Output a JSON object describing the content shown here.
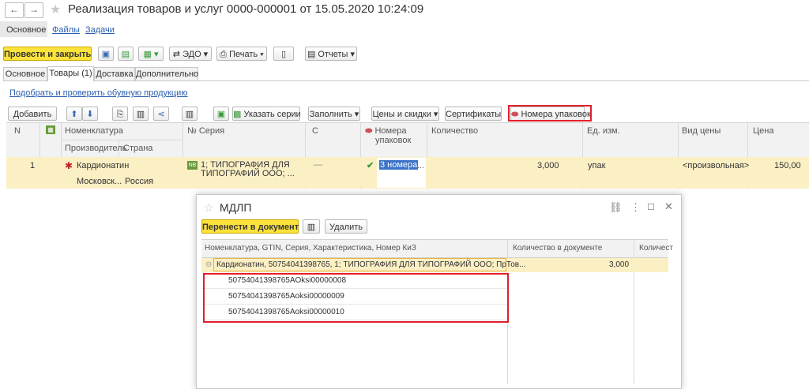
{
  "window": {
    "title": "Реализация товаров и услуг 0000-000001 от 15.05.2020 10:24:09",
    "back": "←",
    "forward": "→",
    "star": "★"
  },
  "nav": {
    "main": "Основное",
    "files": "Файлы",
    "tasks": "Задачи"
  },
  "toolbar": {
    "post_close": "Провести и закрыть",
    "edo": "ЭДО",
    "print": "Печать",
    "reports": "Отчеты"
  },
  "tabs": [
    {
      "label": "Основное"
    },
    {
      "label": "Товары (1)"
    },
    {
      "label": "Доставка"
    },
    {
      "label": "Дополнительно"
    }
  ],
  "pick_link": "Подобрать и проверить обувную продукцию",
  "goods_toolbar": {
    "add": "Добавить",
    "series": "Указать серии",
    "fill": "Заполнить",
    "prices": "Цены и скидки",
    "certs": "Сертификаты",
    "pack_numbers": "Номера упаковок"
  },
  "table": {
    "headers": {
      "n": "N",
      "nomenclature": "Номенклатура",
      "producer": "Производитель",
      "country": "Страна",
      "series": "Серия",
      "c": "С",
      "pack_numbers_1": "Номера",
      "pack_numbers_2": "упаковок",
      "quantity": "Количество",
      "unit": "Ед. изм.",
      "price_type": "Вид цены",
      "price": "Цена"
    },
    "rows": [
      {
        "n": "1",
        "nomenclature": "Кардионатин",
        "producer": "Московск...",
        "country": "Россия",
        "series_1": "1; ТИПОГРАФИЯ ДЛЯ",
        "series_2": "ТИПОГРАФИЙ ООО; ...",
        "c": "—",
        "pack_numbers": "3 номера",
        "pack_more": "...",
        "quantity": "3,000",
        "unit": "упак",
        "price_type": "<произвольная>",
        "price": "150,00"
      }
    ]
  },
  "dialog": {
    "title": "МДЛП",
    "transfer": "Перенести в документ",
    "delete": "Удалить",
    "col_nomenclature": "Номенклатура, GTIN, Серия, Характеристика, Номер КиЗ",
    "col_qty_doc": "Количество в документе",
    "col_qty": "Количест",
    "group_row": "Кардионатин, 50754041398765, 1; ТИПОГРАФИЯ ДЛЯ ТИПОГРАФИЙ ООО; ПрТов...",
    "group_qty": "3,000",
    "codes": [
      "50754041398765AOksi00000008",
      "50754041398765Aoksi00000009",
      "50754041398765Aoksi00000010"
    ]
  },
  "colors": {
    "accent": "#fce33c",
    "row_highlight": "#fbefc4",
    "red_frame": "#e0202c",
    "link": "#2a5fb0"
  }
}
